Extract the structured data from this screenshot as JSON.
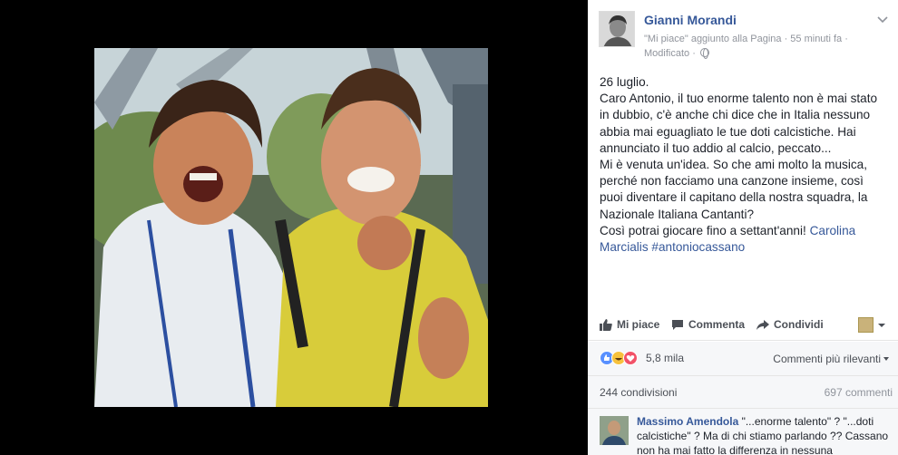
{
  "post": {
    "author": "Gianni Morandi",
    "meta": "\"Mi piace\" aggiunto alla Pagina · 55 minuti fa · Modificato ·",
    "body": [
      {
        "text": "26 luglio."
      },
      {
        "text": "Caro Antonio, il tuo enorme talento non è mai stato in dubbio, c'è anche chi dice che in Italia nessuno abbia mai eguagliato le tue doti calcistiche. Hai annunciato il tuo addio al calcio, peccato..."
      },
      {
        "text": "Mi è venuta un'idea. So che ami molto la musica, perché non facciamo una canzone insieme, così puoi diventare il capitano della nostra squadra, la Nazionale Italiana Cantanti?"
      },
      {
        "text": "Così potrai giocare fino a settant'anni! ",
        "link": "Carolina Marcialis #antoniocassano"
      }
    ]
  },
  "actions": {
    "like": "Mi piace",
    "comment": "Commenta",
    "share": "Condividi"
  },
  "reactions": {
    "count": "5,8 mila",
    "sort": "Commenti più rilevanti"
  },
  "stats": {
    "shares": "244 condivisioni",
    "comments": "697 commenti"
  },
  "first_comment": {
    "author": "Massimo Amendola",
    "text": " \"...enorme talento\" ? \"...doti calcistiche\" ? Ma di chi stiamo parlando ?? Cassano non ha mai fatto la differenza in nessuna"
  },
  "icons": {
    "like": "thumbs-up-icon",
    "comment": "speech-bubble-icon",
    "share": "share-arrow-icon",
    "privacy": "globe-icon",
    "menu": "chevron-down-icon"
  },
  "colors": {
    "link": "#365899",
    "secondary_text": "#90949c",
    "like_blue": "#5890ff",
    "haha_yellow": "#f7c23d",
    "love_red": "#f25268"
  }
}
